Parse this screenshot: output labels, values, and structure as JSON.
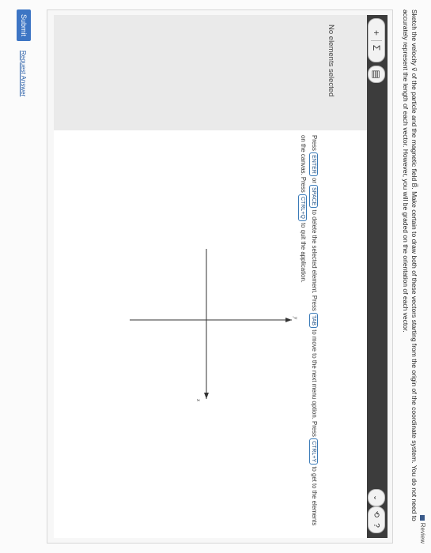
{
  "review": {
    "label": "Review"
  },
  "instructions": {
    "text": "Sketch the velocity v⃗ of the particle and the magnetic field B⃗. Make certain to draw both of these vectors starting from the origin of the coordinate system. You do not need to accurately represent the length of each vector. However, you will be graded on the orientation of each vector."
  },
  "toolbar": {
    "add_icon": "+",
    "sum_icon": "Σ",
    "delete_icon": "▤",
    "chevron_icon": "⌄",
    "reset_icon": "⟲",
    "help_icon": "?"
  },
  "panel": {
    "status": "No elements selected"
  },
  "keyboard_help": {
    "press1": "Press",
    "enter_key": "ENTER",
    "or": "or",
    "space_key": "SPACE",
    "text1": "to delete the selected element. Press",
    "tab_key": "TAB",
    "text2": "to move to the next menu option. Press",
    "ctrly_key": "CTRL+Y",
    "text3": "to get to the elements on the canvas. Press",
    "ctrlq_key": "CTRL+Q",
    "text4": "to quit the application."
  },
  "axes": {
    "x_label": "y",
    "y_label": "x"
  },
  "footer": {
    "submit_label": "Submit",
    "request_label": "Request Answer"
  }
}
